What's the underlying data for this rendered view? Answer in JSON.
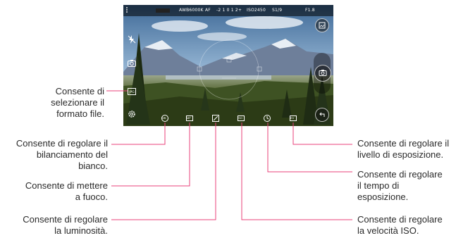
{
  "status_bar": {
    "wb": "AWB6000K",
    "af": "AF",
    "ev": "-2 1 0 1 2+",
    "iso": "ISO2450",
    "shutter": "S1/9",
    "fstop": "F1.8"
  },
  "callouts": {
    "file_format": "Consente di\nselezionare il\nformato file.",
    "white_balance": "Consente di regolare il\nbilanciamento del\nbianco.",
    "focus": "Consente di mettere\na fuoco.",
    "brightness": "Consente di regolare\nla luminosità.",
    "exposure_level": "Consente di regolare il\nlivello di esposizione.",
    "exposure_time": "Consente di regolare\nil tempo di\nesposizione.",
    "iso_speed": "Consente di regolare\nla velocità ISO."
  },
  "icons": {
    "flash": "flash-off-icon",
    "switch_camera": "switch-camera-icon",
    "file_format": "file-format-icon",
    "settings": "gear-icon",
    "gallery": "gallery-icon",
    "shutter": "camera-shutter-icon",
    "back": "back-icon",
    "wb_button": "white-balance-icon",
    "focus_button": "manual-focus-icon",
    "brightness_button": "brightness-icon",
    "iso_button": "iso-icon",
    "shutter_speed_button": "shutter-speed-icon",
    "exposure_button": "exposure-icon"
  },
  "bottom_labels": {
    "wb": "WB",
    "focus": "MF",
    "iso": "ISO",
    "exposure": "EV"
  }
}
